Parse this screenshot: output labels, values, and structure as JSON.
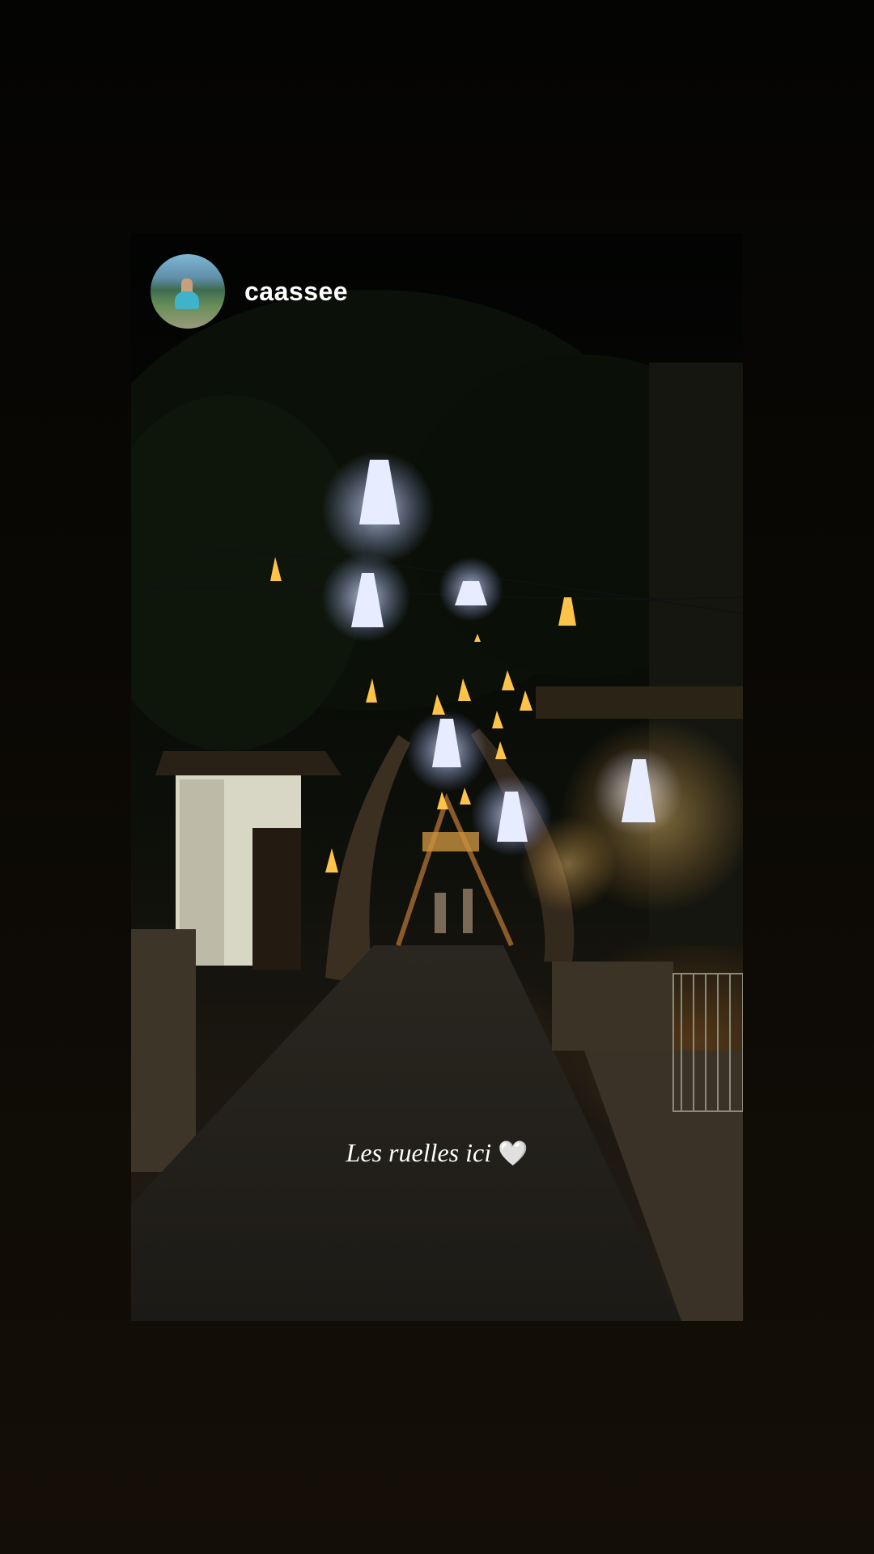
{
  "story": {
    "username": "caassee",
    "avatar_icon": "profile-avatar",
    "caption_text": "Les ruelles ici",
    "caption_icon": "heart-icon",
    "caption_heart": "🤍"
  }
}
